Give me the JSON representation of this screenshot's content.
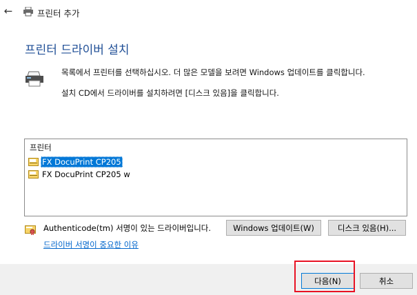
{
  "window": {
    "title": "프린터 추가"
  },
  "page": {
    "heading": "프린터 드라이버 설치",
    "instructions": [
      "목록에서 프린터를 선택하십시오. 더 많은 모델을 보려면 Windows 업데이트를 클릭합니다.",
      "설치 CD에서 드라이버를 설치하려면 [디스크 있음]을 클릭합니다."
    ]
  },
  "printer_list": {
    "header": "프린터",
    "items": [
      {
        "label": "FX DocuPrint CP205",
        "selected": true
      },
      {
        "label": "FX DocuPrint CP205 w",
        "selected": false
      }
    ]
  },
  "signature": {
    "text": "Authenticode(tm) 서명이 있는 드라이버입니다.",
    "link": "드라이버 서명이 중요한 이유"
  },
  "buttons": {
    "windows_update": "Windows 업데이트(W)",
    "have_disk": "디스크 있음(H)...",
    "next": "다음(N)",
    "cancel": "취소"
  },
  "colors": {
    "heading": "#1f4e96",
    "link": "#0066cc",
    "selection": "#0078d7",
    "highlight_box": "#e81123",
    "footer_bg": "#f0f0f0"
  }
}
